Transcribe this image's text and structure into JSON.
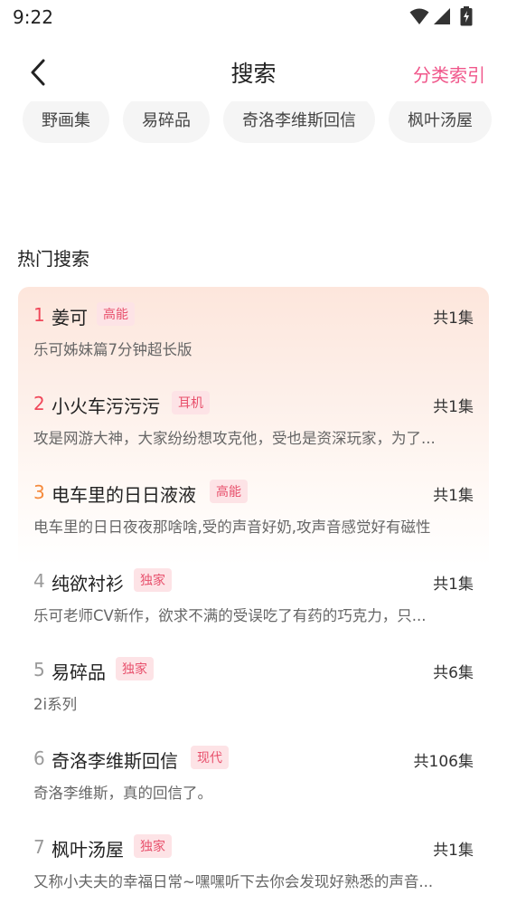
{
  "status_bar": {
    "time": "9:22",
    "icons": [
      "wifi-icon",
      "signal-icon",
      "battery-charging-icon"
    ]
  },
  "header": {
    "back_icon": "chevron-left-icon",
    "title": "搜索",
    "category_index_label": "分类索引",
    "accent_color": "#f0568a"
  },
  "search_history": {
    "chips": [
      "野画集",
      "易碎品",
      "奇洛李维斯回信",
      "枫叶汤屋"
    ]
  },
  "hot_search": {
    "title": "热门搜索",
    "items": [
      {
        "rank": "1",
        "name": "姜可",
        "tag": "高能",
        "count": "共1集",
        "desc": "乐可姊妹篇7分钟超长版"
      },
      {
        "rank": "2",
        "name": "小火车污污污",
        "tag": "耳机",
        "count": "共1集",
        "desc": "攻是网游大神，大家纷纷想攻克他，受也是资深玩家，为了..."
      },
      {
        "rank": "3",
        "name": "电车里的日日液液",
        "tag": "高能",
        "count": "共1集",
        "desc": "电车里的日日夜夜那啥啥,受的声音好奶,攻声音感觉好有磁性"
      },
      {
        "rank": "4",
        "name": "纯欲衬衫",
        "tag": "独家",
        "count": "共1集",
        "desc": "乐可老师CV新作，欲求不满的受误吃了有药的巧克力，只..."
      },
      {
        "rank": "5",
        "name": "易碎品",
        "tag": "独家",
        "count": "共6集",
        "desc": "2i系列"
      },
      {
        "rank": "6",
        "name": "奇洛李维斯回信",
        "tag": "现代",
        "count": "共106集",
        "desc": "奇洛李维斯，真的回信了。"
      },
      {
        "rank": "7",
        "name": "枫叶汤屋",
        "tag": "独家",
        "count": "共1集",
        "desc": "又称小夫夫的幸福日常~嘿嘿听下去你会发现好熟悉的声音..."
      }
    ]
  }
}
